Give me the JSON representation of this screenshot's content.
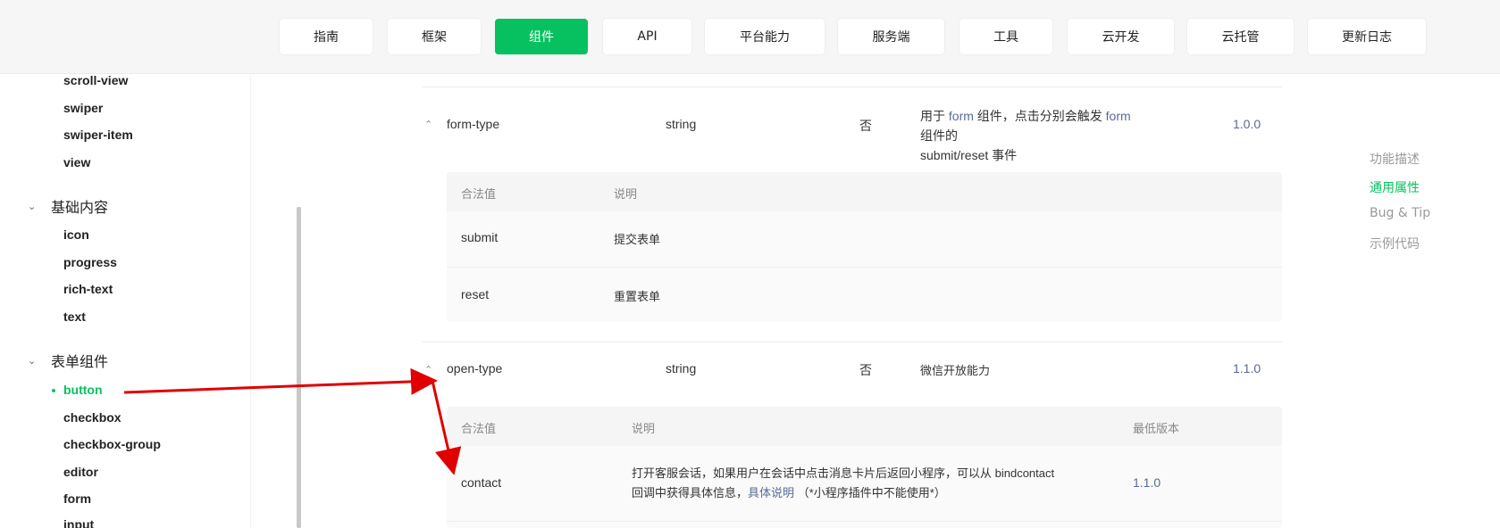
{
  "nav": {
    "tabs": [
      {
        "label": "指南"
      },
      {
        "label": "框架"
      },
      {
        "label": "组件",
        "active": true
      },
      {
        "label": "API"
      },
      {
        "label": "平台能力"
      },
      {
        "label": "服务端"
      },
      {
        "label": "工具"
      },
      {
        "label": "云开发"
      },
      {
        "label": "云托管"
      },
      {
        "label": "更新日志"
      }
    ]
  },
  "sidebar": {
    "items_top": [
      "scroll-view",
      "swiper",
      "swiper-item",
      "view"
    ],
    "group_basic": "基础内容",
    "items_basic": [
      "icon",
      "progress",
      "rich-text",
      "text"
    ],
    "group_form": "表单组件",
    "items_form": [
      "button",
      "checkbox",
      "checkbox-group",
      "editor",
      "form",
      "input"
    ],
    "active_item": "button"
  },
  "props": {
    "form_type": {
      "name": "form-type",
      "type": "string",
      "required": "否",
      "desc_pre": "用于 ",
      "desc_link1": "form",
      "desc_mid": " 组件，点击分别会触发 ",
      "desc_link2": "form",
      "desc_post": " 组件的",
      "desc_line2": "submit/reset 事件",
      "version": "1.0.0",
      "sub_head": {
        "col1": "合法值",
        "col2": "说明"
      },
      "rows": [
        {
          "value": "submit",
          "desc": "提交表单"
        },
        {
          "value": "reset",
          "desc": "重置表单"
        }
      ]
    },
    "open_type": {
      "name": "open-type",
      "type": "string",
      "required": "否",
      "desc": "微信开放能力",
      "version": "1.1.0",
      "sub_head": {
        "col1": "合法值",
        "col2": "说明",
        "col3": "最低版本"
      },
      "rows": [
        {
          "value": "contact",
          "desc_line1": "打开客服会话，如果用户在会话中点击消息卡片后返回小程序，可以从 bindcontact",
          "desc_line2_pre": "回调中获得具体信息，",
          "desc_link": "具体说明",
          "desc_line2_post": " （*小程序插件中不能使用*）",
          "version": "1.1.0"
        }
      ]
    }
  },
  "toc": {
    "items": [
      "功能描述",
      "通用属性",
      "Bug & Tip",
      "示例代码"
    ],
    "active": "通用属性"
  },
  "colors": {
    "brand": "#07c160",
    "link": "#576b95",
    "annotation_arrow": "#e00000"
  }
}
